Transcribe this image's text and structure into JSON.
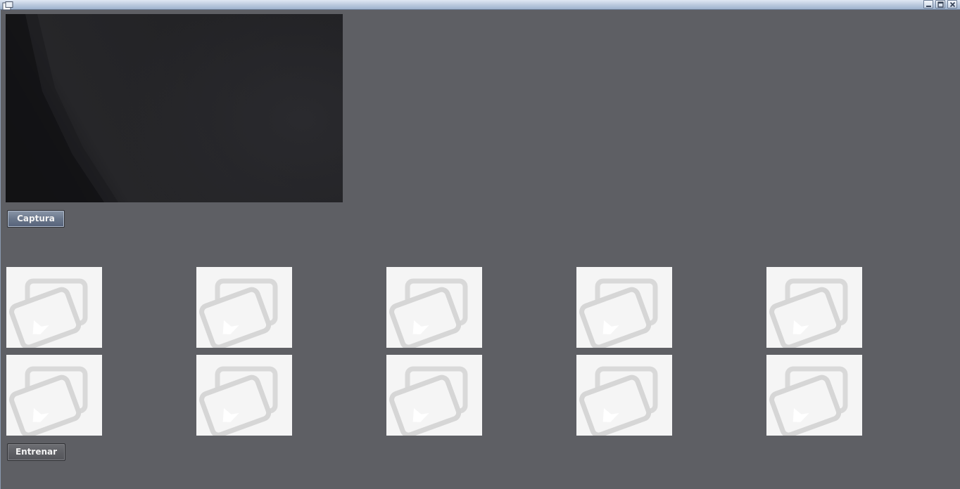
{
  "window": {
    "title": "",
    "controls": [
      "minimize-icon",
      "maximize-icon",
      "close-icon"
    ]
  },
  "camera": {
    "description_icon": "camera-feed"
  },
  "buttons": {
    "capture_label": "Captura",
    "train_label": "Entrenar"
  },
  "thumbnails": {
    "row1": [
      "image-placeholder-icon",
      "image-placeholder-icon",
      "image-placeholder-icon",
      "image-placeholder-icon",
      "image-placeholder-icon"
    ],
    "row2": [
      "image-placeholder-icon",
      "image-placeholder-icon",
      "image-placeholder-icon",
      "image-placeholder-icon",
      "image-placeholder-icon"
    ]
  },
  "colors": {
    "background": "#5e5f64",
    "titlebar": "#b9c8dd",
    "thumbnail_bg": "#f5f5f5",
    "placeholder_stroke": "#d8d8d8"
  }
}
